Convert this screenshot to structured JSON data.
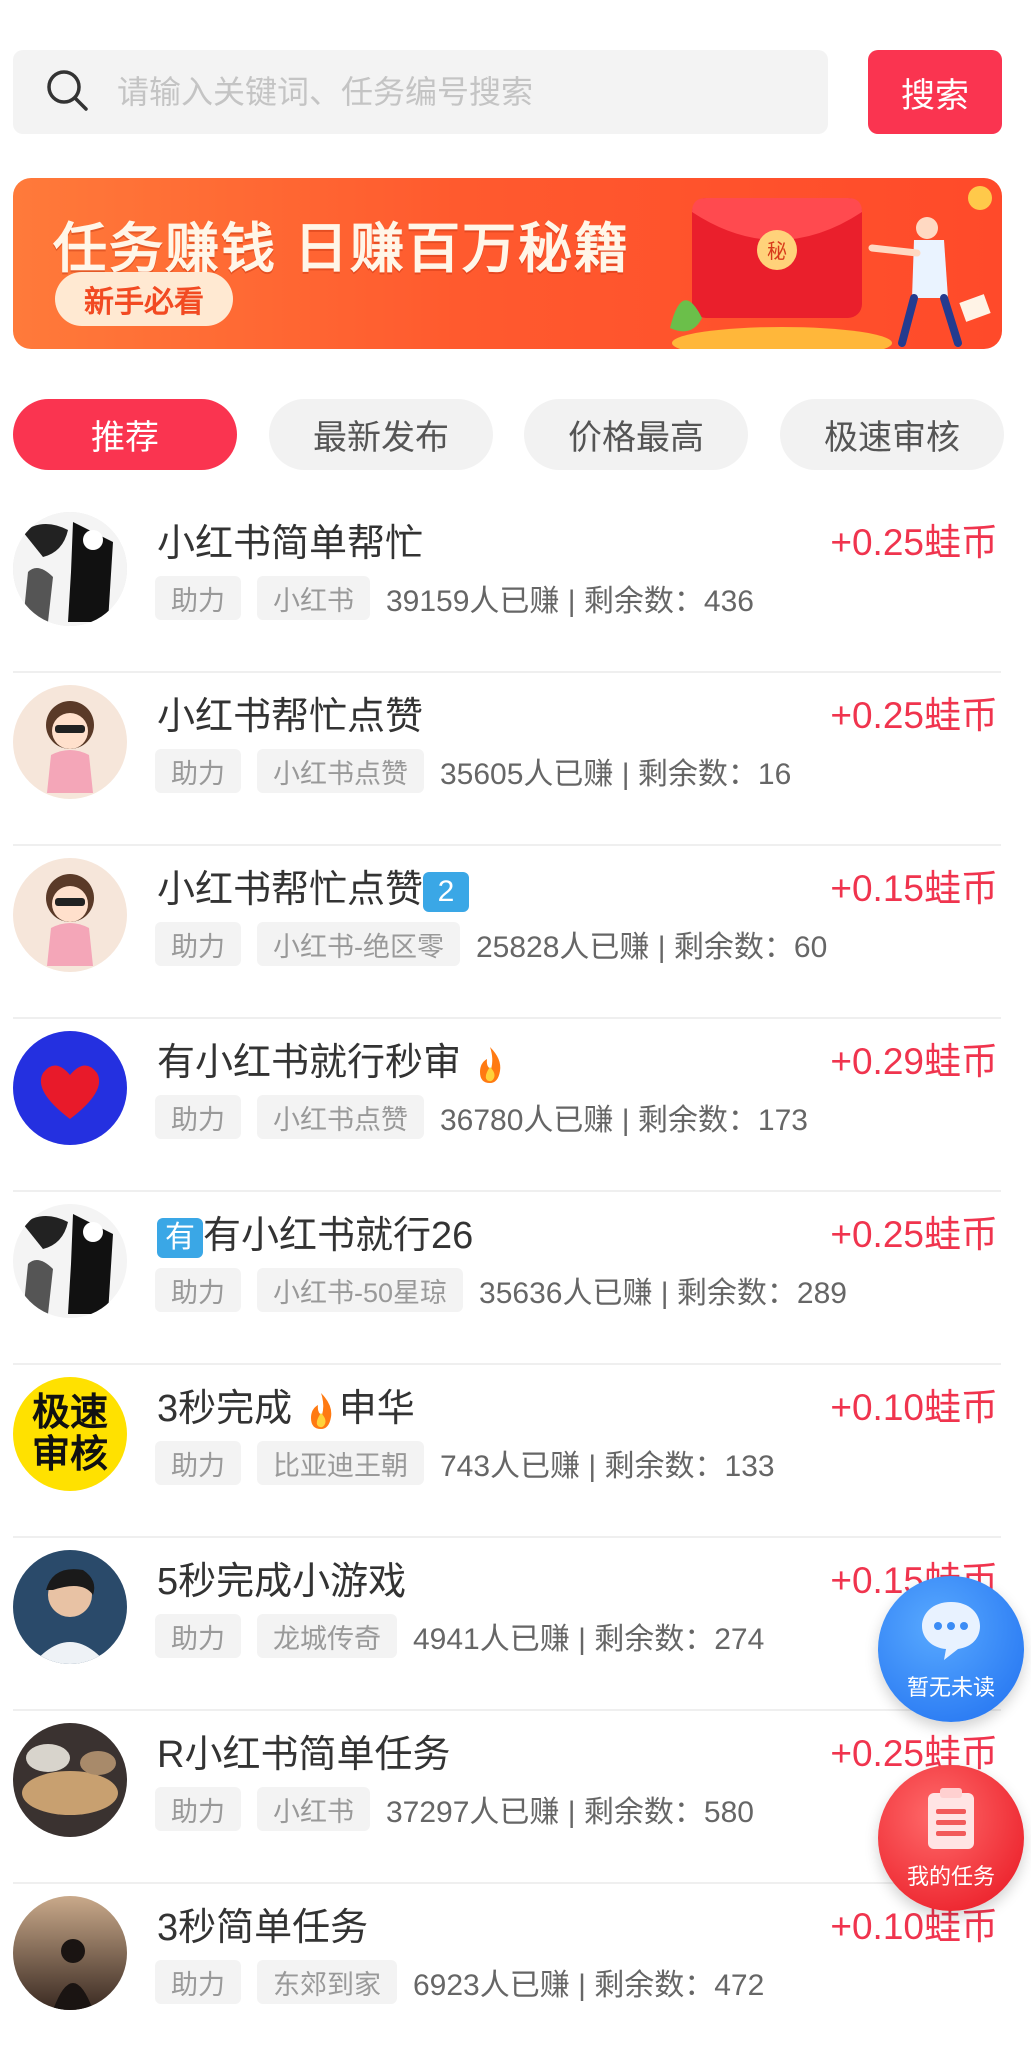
{
  "search": {
    "placeholder": "请输入关键词、任务编号搜索",
    "button_label": "搜索"
  },
  "banner": {
    "title": "任务赚钱  日赚百万秘籍",
    "pill": "新手必看",
    "badge": "秘"
  },
  "tabs": [
    {
      "label": "推荐",
      "active": true
    },
    {
      "label": "最新发布",
      "active": false
    },
    {
      "label": "价格最高",
      "active": false
    },
    {
      "label": "极速审核",
      "active": false
    }
  ],
  "tasks": [
    {
      "title": "小红书简单帮忙",
      "reward": "+0.25蛙币",
      "tags": [
        "助力",
        "小红书"
      ],
      "stats": "39159人已赚 | 剩余数：436",
      "avatar": "comic"
    },
    {
      "title": "小红书帮忙点赞",
      "reward": "+0.25蛙币",
      "tags": [
        "助力",
        "小红书点赞"
      ],
      "stats": "35605人已赚 | 剩余数：16",
      "avatar": "cartoon-girl"
    },
    {
      "title": "小红书帮忙点赞",
      "title_emoji_box": "2",
      "reward": "+0.15蛙币",
      "tags": [
        "助力",
        "小红书-绝区零"
      ],
      "stats": "25828人已赚 | 剩余数：60",
      "avatar": "cartoon-girl"
    },
    {
      "title": "有小红书就行秒审",
      "title_fire": true,
      "reward": "+0.29蛙币",
      "tags": [
        "助力",
        "小红书点赞"
      ],
      "stats": "36780人已赚 | 剩余数：173",
      "avatar": "red-heart"
    },
    {
      "title_emoji_box": "有",
      "title": "有小红书就行26",
      "reward": "+0.25蛙币",
      "tags": [
        "助力",
        "小红书-50星琼"
      ],
      "stats": "35636人已赚 | 剩余数：289",
      "avatar": "comic"
    },
    {
      "title_part1": "3秒完成",
      "title_part2": "申华",
      "reward": "+0.10蛙币",
      "tags": [
        "助力",
        "比亚迪王朝"
      ],
      "stats": "743人已赚 | 剩余数：133",
      "avatar": "fast-review",
      "avatar_text": "极速审核"
    },
    {
      "title": "5秒完成小游戏",
      "reward": "+0.15蛙币",
      "tags": [
        "助力",
        "龙城传奇"
      ],
      "stats": "4941人已赚 | 剩余数：274",
      "avatar": "man-photo"
    },
    {
      "title": "R小红书简单任务",
      "reward": "+0.25蛙币",
      "tags": [
        "助力",
        "小红书"
      ],
      "stats": "37297人已赚 | 剩余数：580",
      "avatar": "food-photo"
    },
    {
      "title": "3秒简单任务",
      "reward": "+0.10蛙币",
      "tags": [
        "助力",
        "东郊到家"
      ],
      "stats": "6923人已赚 | 剩余数：472",
      "avatar": "sunset-photo"
    }
  ],
  "floating": {
    "messages_label": "暂无未读",
    "my_tasks_label": "我的任务"
  },
  "colors": {
    "accent": "#fa3450",
    "reward": "#f0344e"
  }
}
